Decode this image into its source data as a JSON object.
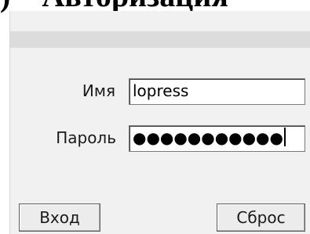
{
  "header": {
    "heading_fragment": ") – Авторизация"
  },
  "form": {
    "username_label": "Имя",
    "username_value": "lopress",
    "password_label": "Пароль",
    "password_mask": "●●●●●●●●●●●",
    "login_button": "Вход",
    "reset_button": "Сброс"
  }
}
